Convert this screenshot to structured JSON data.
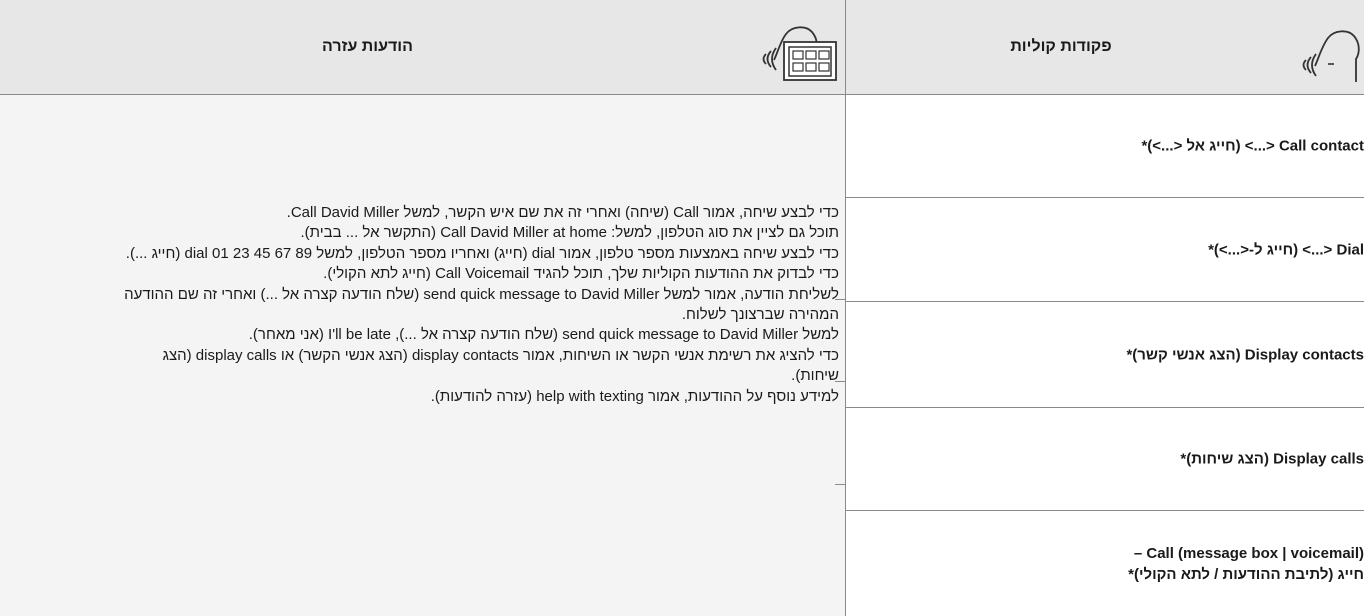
{
  "help_column": {
    "icon": "voice-keypad-icon",
    "title": "הודעות עזרה",
    "paragraphs": [
      "כדי לבצע שיחה, אמור Call (שיחה) ואחרי זה את שם איש הקשר, למשל Call David Miller.",
      "תוכל גם לציין את סוג הטלפון, למשל: Call David Miller at home (התקשר אל ... בבית).",
      "כדי לבצע שיחה באמצעות מספר טלפון, אמור dial (חייג) ואחריו מספר הטלפון, למשל dial 01 23 45 67 89 (חייג ...).",
      "כדי לבדוק את ההודעות הקוליות שלך, תוכל להגיד Call Voicemail (חייג לתא הקולי).",
      "לשליחת הודעה, אמור למשל send quick message to David Miller (שלח הודעה קצרה אל ...) ואחרי זה שם ההודעה המהירה שברצונך לשלוח.",
      "למשל send quick message to David Miller (שלח הודעה קצרה אל ...), I'll be late (אני מאחר).",
      "כדי להציג את רשימת אנשי הקשר או השיחות, אמור display contacts (הצג אנשי הקשר) או display calls (הצג שיחות).",
      "למידע נוסף על ההודעות, אמור help with texting (עזרה להודעות)."
    ]
  },
  "commands_column": {
    "icon": "voice-command-icon",
    "title": "פקודות קוליות",
    "items": [
      {
        "label": "Call contact <...> (חייג אל <...>)*"
      },
      {
        "label": "Dial <...> (חייג ל-<...>)*"
      },
      {
        "label": "Display contacts (הצג אנשי קשר)*"
      },
      {
        "label": "Display calls (הצג שיחות)*"
      },
      {
        "label_line1": "Call (message box | voicemail) –",
        "label_line2": "חייג (לתיבת ההודעות / לתא הקולי)*"
      }
    ]
  }
}
